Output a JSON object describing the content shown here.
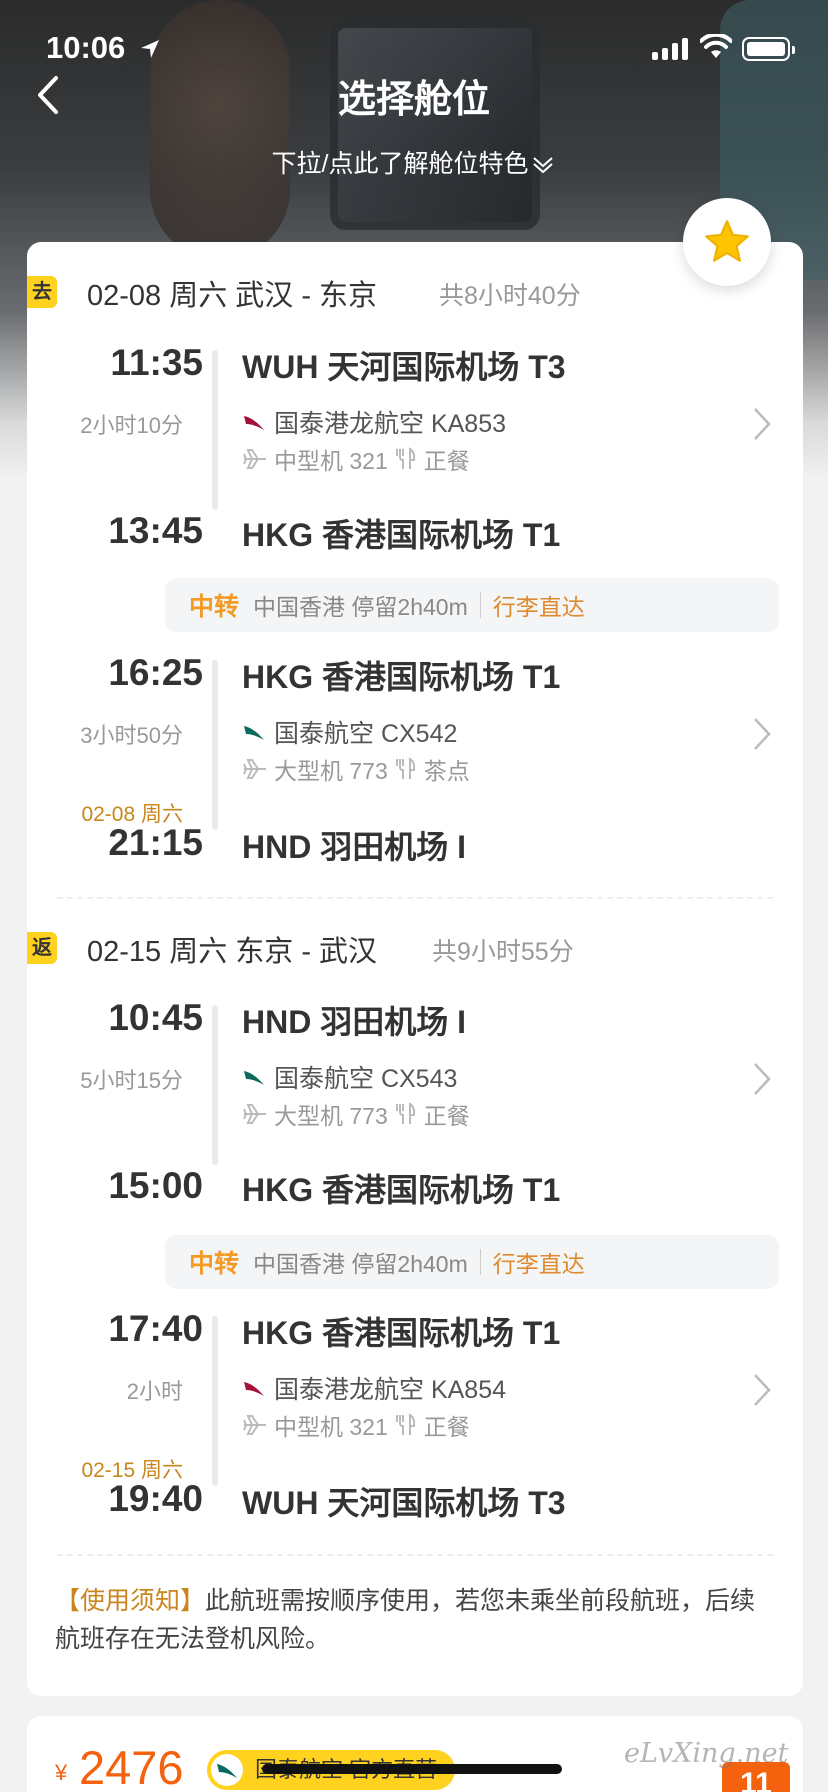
{
  "status_bar": {
    "time": "10:06"
  },
  "header": {
    "title": "选择舱位",
    "subtitle": "下拉/点此了解舱位特色"
  },
  "outbound": {
    "tag": "去",
    "date_route": "02-08  周六 武汉 - 东京",
    "total_duration": "共8小时40分",
    "legs": [
      {
        "dep_time": "11:35",
        "dep_airport": "WUH 天河国际机场 T3",
        "duration": "2小时10分",
        "airline": "国泰港龙航空 KA853",
        "plane": "中型机 321",
        "meal": "正餐",
        "arr_time": "13:45",
        "arr_airport": "HKG 香港国际机场 T1",
        "arr_date": ""
      },
      {
        "dep_time": "16:25",
        "dep_airport": "HKG 香港国际机场 T1",
        "duration": "3小时50分",
        "airline": "国泰航空 CX542",
        "plane": "大型机 773",
        "meal": "茶点",
        "arr_time": "21:15",
        "arr_airport": "HND 羽田机场 I",
        "arr_date": "02-08 周六"
      }
    ],
    "transfer": {
      "label": "中转",
      "detail": "中国香港 停留2h40m",
      "baggage": "行李直达"
    }
  },
  "return": {
    "tag": "返",
    "date_route": "02-15  周六 东京 - 武汉",
    "total_duration": "共9小时55分",
    "legs": [
      {
        "dep_time": "10:45",
        "dep_airport": "HND 羽田机场 I",
        "duration": "5小时15分",
        "airline": "国泰航空 CX543",
        "plane": "大型机 773",
        "meal": "正餐",
        "arr_time": "15:00",
        "arr_airport": "HKG 香港国际机场 T1",
        "arr_date": ""
      },
      {
        "dep_time": "17:40",
        "dep_airport": "HKG 香港国际机场 T1",
        "duration": "2小时",
        "airline": "国泰港龙航空 KA854",
        "plane": "中型机 321",
        "meal": "正餐",
        "arr_time": "19:40",
        "arr_airport": "WUH 天河国际机场 T3",
        "arr_date": "02-15 周六"
      }
    ],
    "transfer": {
      "label": "中转",
      "detail": "中国香港 停留2h40m",
      "baggage": "行李直达"
    }
  },
  "notice": {
    "title": "【使用须知】",
    "text": "此航班需按顺序使用，若您未乘坐前段航班，后续航班存在无法登机风险。"
  },
  "bottom": {
    "currency": "¥",
    "price": "2476",
    "official_badge": "国泰航空 官方直营",
    "promo": "11",
    "watermark": "eLvXing.net"
  },
  "colors": {
    "accent_orange": "#f4620e",
    "tag_yellow": "#ffd21f",
    "transfer_orange": "#f59a23",
    "notice_gold": "#c8861d",
    "dragonair_red": "#a3123a",
    "cathay_green": "#0b6a5e"
  },
  "icons": [
    "back-arrow-icon",
    "chevron-down-icon",
    "star-icon",
    "airline-logo-icon",
    "plane-icon",
    "meal-icon",
    "chevron-right-icon",
    "location-arrow-icon",
    "signal-icon",
    "wifi-icon",
    "battery-icon"
  ]
}
